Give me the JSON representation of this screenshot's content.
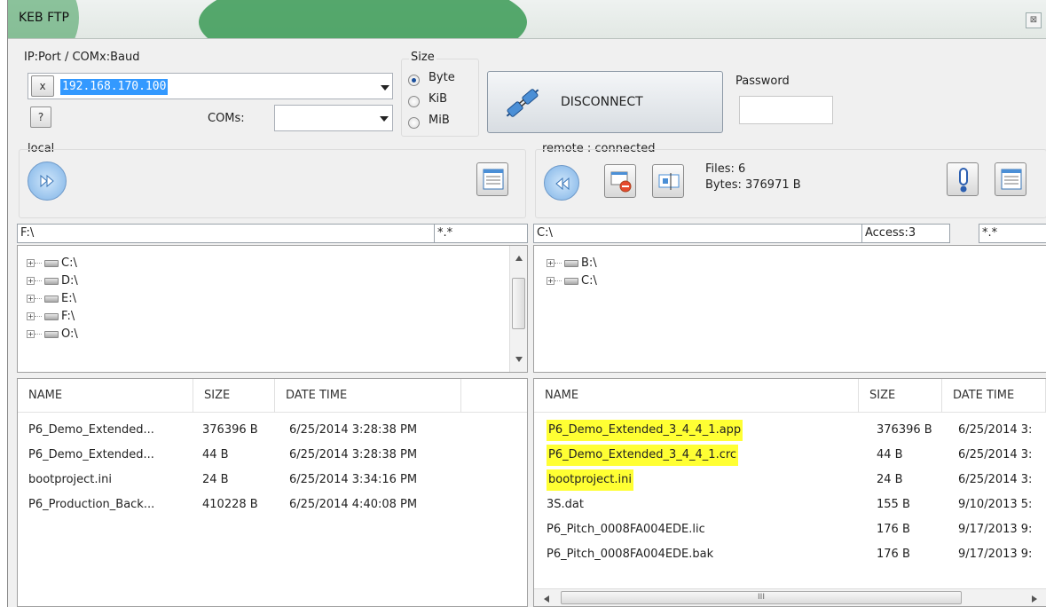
{
  "window": {
    "title": "KEB FTP",
    "close": "⊠"
  },
  "connection": {
    "ip_label": "IP:Port / COMx:Baud",
    "clear_btn": "x",
    "ip_value": "192.168.170.100",
    "help_btn": "?",
    "coms_label": "COMs:",
    "coms_value": "",
    "size_label": "Size",
    "size_options": [
      "Byte",
      "KiB",
      "MiB"
    ],
    "size_selected": "Byte",
    "disconnect_label": "DISCONNECT",
    "password_label": "Password",
    "password_value": ""
  },
  "local": {
    "label": "local",
    "path": "F:\\",
    "filter": "*.*",
    "tree": [
      "C:\\",
      "D:\\",
      "E:\\",
      "F:\\",
      "O:\\"
    ],
    "columns": [
      "NAME",
      "SIZE",
      "DATE TIME"
    ],
    "files": [
      {
        "name": "P6_Demo_Extended...",
        "size": "376396 B",
        "date": "6/25/2014 3:28:38 PM"
      },
      {
        "name": "P6_Demo_Extended...",
        "size": "44 B",
        "date": "6/25/2014 3:28:38 PM"
      },
      {
        "name": "bootproject.ini",
        "size": "24 B",
        "date": "6/25/2014 3:34:16 PM"
      },
      {
        "name": "P6_Production_Back...",
        "size": "410228 B",
        "date": "6/25/2014 4:40:08 PM"
      }
    ]
  },
  "remote": {
    "label": "remote : connected",
    "files_count": "Files: 6",
    "bytes": "Bytes: 376971 B",
    "path": "C:\\",
    "access": "Access:3",
    "filter": "*.*",
    "tree": [
      "B:\\",
      "C:\\"
    ],
    "columns": [
      "NAME",
      "SIZE",
      "DATE TIME"
    ],
    "files": [
      {
        "name": "P6_Demo_Extended_3_4_4_1.app",
        "size": "376396 B",
        "date": "6/25/2014 3:",
        "highlight": true
      },
      {
        "name": "P6_Demo_Extended_3_4_4_1.crc",
        "size": "44 B",
        "date": "6/25/2014 3:",
        "highlight": true
      },
      {
        "name": "bootproject.ini",
        "size": "24 B",
        "date": "6/25/2014 3:",
        "highlight": true
      },
      {
        "name": "3S.dat",
        "size": "155 B",
        "date": "9/10/2013 5:",
        "highlight": false
      },
      {
        "name": "P6_Pitch_0008FA004EDE.lic",
        "size": "176 B",
        "date": "9/17/2013 9:",
        "highlight": false
      },
      {
        "name": "P6_Pitch_0008FA004EDE.bak",
        "size": "176 B",
        "date": "9/17/2013 9:",
        "highlight": false
      }
    ],
    "hscroll_grip": "III"
  },
  "colors": {
    "highlight": "#ffff33",
    "accent": "#3a8fd8",
    "title_green": "#3a9a55"
  }
}
